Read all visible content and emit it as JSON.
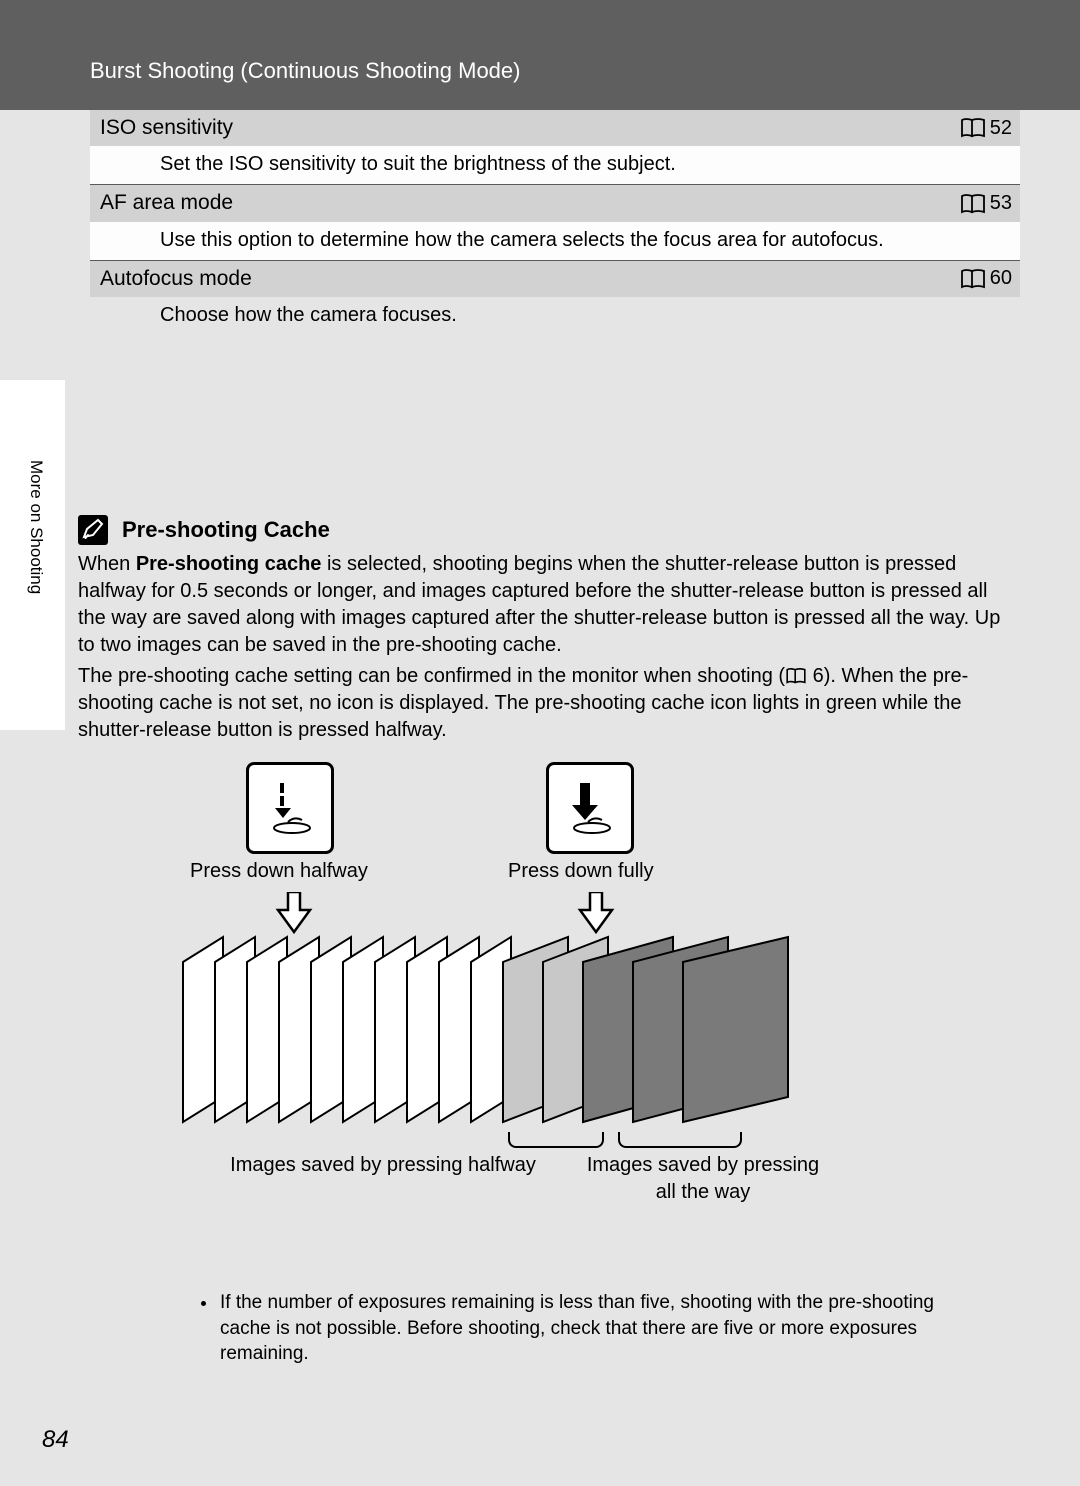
{
  "header": {
    "title": "Burst Shooting (Continuous Shooting Mode)"
  },
  "settings": [
    {
      "title": "ISO sensitivity",
      "page": "52",
      "desc": "Set the ISO sensitivity to suit the brightness of the subject."
    },
    {
      "title": "AF area mode",
      "page": "53",
      "desc": "Use this option to determine how the camera selects the focus area for autofocus."
    },
    {
      "title": "Autofocus mode",
      "page": "60",
      "desc": "Choose how the camera focuses."
    }
  ],
  "sidebar": {
    "label": "More on Shooting"
  },
  "callout": {
    "heading": "Pre-shooting Cache",
    "p1_pre": "When ",
    "p1_bold": "Pre-shooting cache",
    "p1_post": " is selected, shooting begins when the shutter-release button is pressed halfway for 0.5 seconds or longer, and images captured before the shutter-release button is pressed all the way are saved along with images captured after the shutter-release button is pressed all the way. Up to two images can be saved in the pre-shooting cache.",
    "p2_pre": "The pre-shooting cache setting can be confirmed in the monitor when shooting (",
    "p2_ref": "6",
    "p2_post": "). When the pre-shooting cache is not set, no icon is displayed. The pre-shooting cache icon lights in green while the shutter-release button is pressed halfway."
  },
  "illustration": {
    "press_half": "Press down halfway",
    "press_full": "Press down fully",
    "label_half": "Images saved by pressing halfway",
    "label_full_line1": "Images saved by pressing",
    "label_full_line2": "all the way"
  },
  "bullet": "If the number of exposures remaining is less than five, shooting with the pre-shooting cache is not possible. Before shooting, check that there are five or more exposures remaining.",
  "page_number": "84"
}
